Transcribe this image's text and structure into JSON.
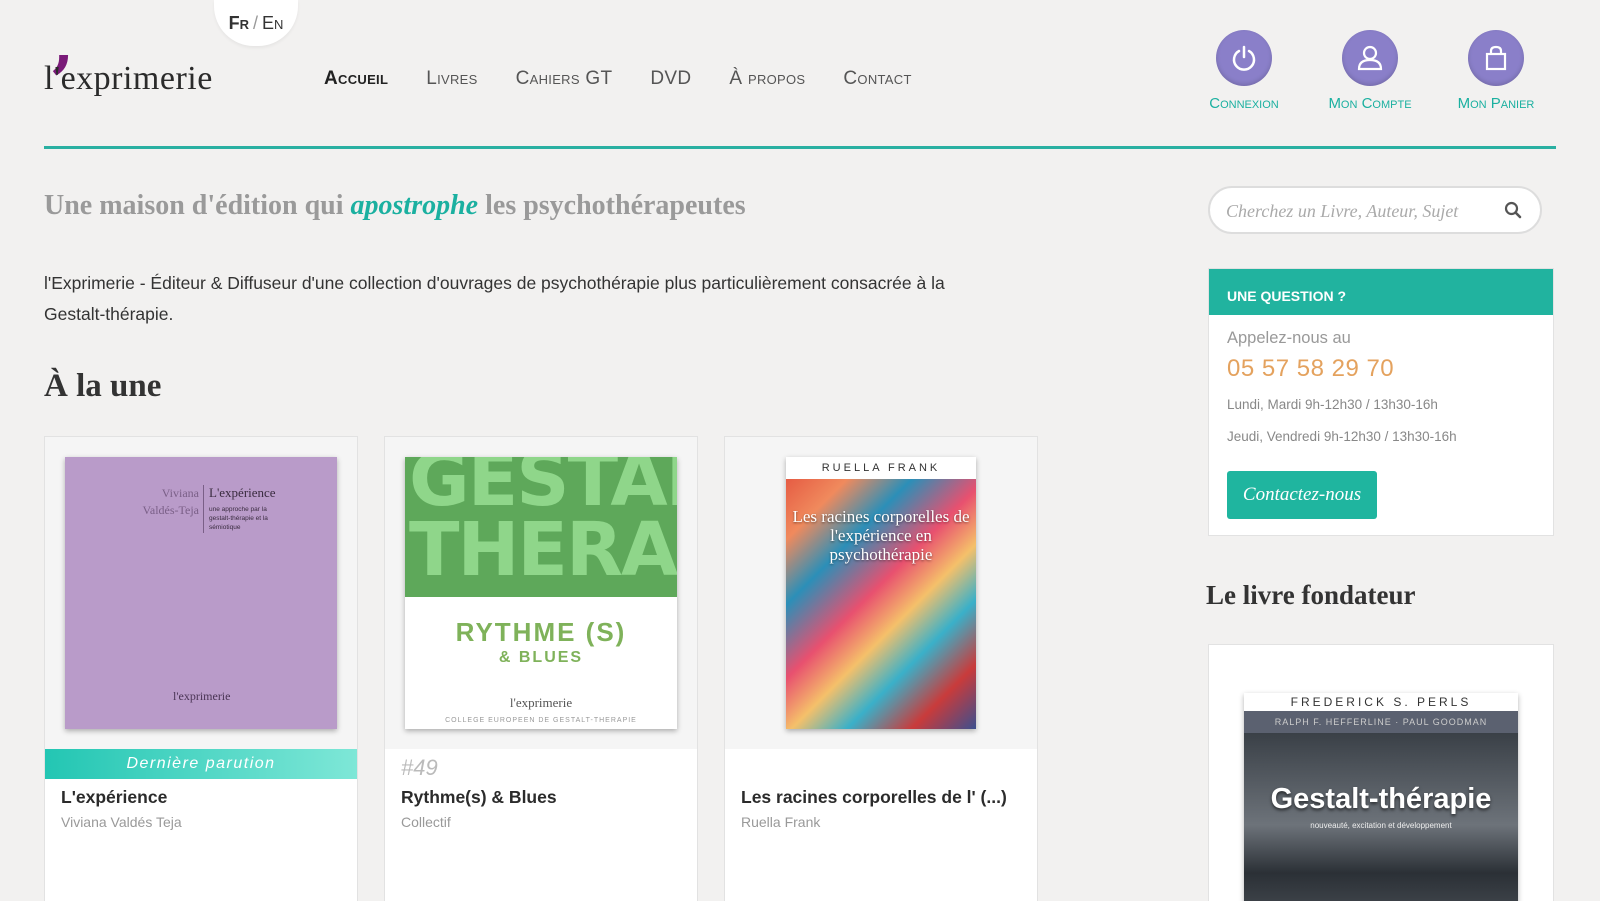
{
  "header": {
    "logo_text": "l'exprimerie",
    "lang": {
      "fr": "Fr",
      "separator": "/",
      "en": "En"
    },
    "nav": [
      {
        "label": "Accueil",
        "active": true
      },
      {
        "label": "Livres"
      },
      {
        "label": "Cahiers GT"
      },
      {
        "label": "DVD"
      },
      {
        "label": "À propos"
      },
      {
        "label": "Contact"
      }
    ],
    "tools": [
      {
        "label": "Connexion",
        "icon": "power-icon"
      },
      {
        "label": "Mon Compte",
        "icon": "user-icon"
      },
      {
        "label": "Mon Panier",
        "icon": "shopping-bag-icon"
      }
    ],
    "accent_color": "#2ab0a2",
    "icon_circle_color": "#8a7fc9"
  },
  "main": {
    "tagline": {
      "before": "Une maison d'édition qui ",
      "highlight": "apostrophe",
      "after": " les psychothérapeutes"
    },
    "intro": "l'Exprimerie - Éditeur & Diffuseur d'une collection d'ouvrages de psychothérapie plus particulièrement consacrée à la Gestalt-thérapie.",
    "section_title": "À la une",
    "books": [
      {
        "ribbon": "Dernière parution",
        "title": "L'expérience",
        "author": "Viviana Valdés Teja",
        "cover": {
          "author_lines": [
            "Viviana",
            "Valdés-Teja"
          ],
          "title": "L'expérience",
          "subtitle": "une approche par la gestalt-thérapie et la sémiotique",
          "publisher": "l'exprimerie"
        }
      },
      {
        "issue": "#49",
        "title": "Rythme(s) & Blues",
        "author": "Collectif",
        "cover": {
          "big_text": "GESTALT THERAPIE",
          "title": "RYTHME (S)",
          "subtitle": "& BLUES",
          "publisher": "l'exprimerie",
          "footer": "COLLEGE EUROPEEN DE GESTALT-THERAPIE"
        }
      },
      {
        "title": "Les racines corporelles de l' (...)",
        "author": "Ruella Frank",
        "cover": {
          "header": "RUELLA FRANK",
          "title": "Les racines corporelles de l'expérience en psychothérapie"
        }
      }
    ]
  },
  "sidebar": {
    "search_placeholder": "Cherchez un Livre, Auteur, Sujet",
    "question": {
      "heading": "UNE QUESTION ?",
      "call": "Appelez-nous au",
      "phone": "05 57 58 29 70",
      "hours_1": "Lundi, Mardi 9h-12h30 / 13h30-16h",
      "hours_2": "Jeudi, Vendredi 9h-12h30 / 13h30-16h",
      "button": "Contactez-nous"
    },
    "founder_title": "Le livre fondateur",
    "founder_cover": {
      "author": "FREDERICK S. PERLS",
      "coauthors": "RALPH F. HEFFERLINE · PAUL GOODMAN",
      "title": "Gestalt-thérapie",
      "subtitle": "nouveauté, excitation et développement"
    }
  }
}
